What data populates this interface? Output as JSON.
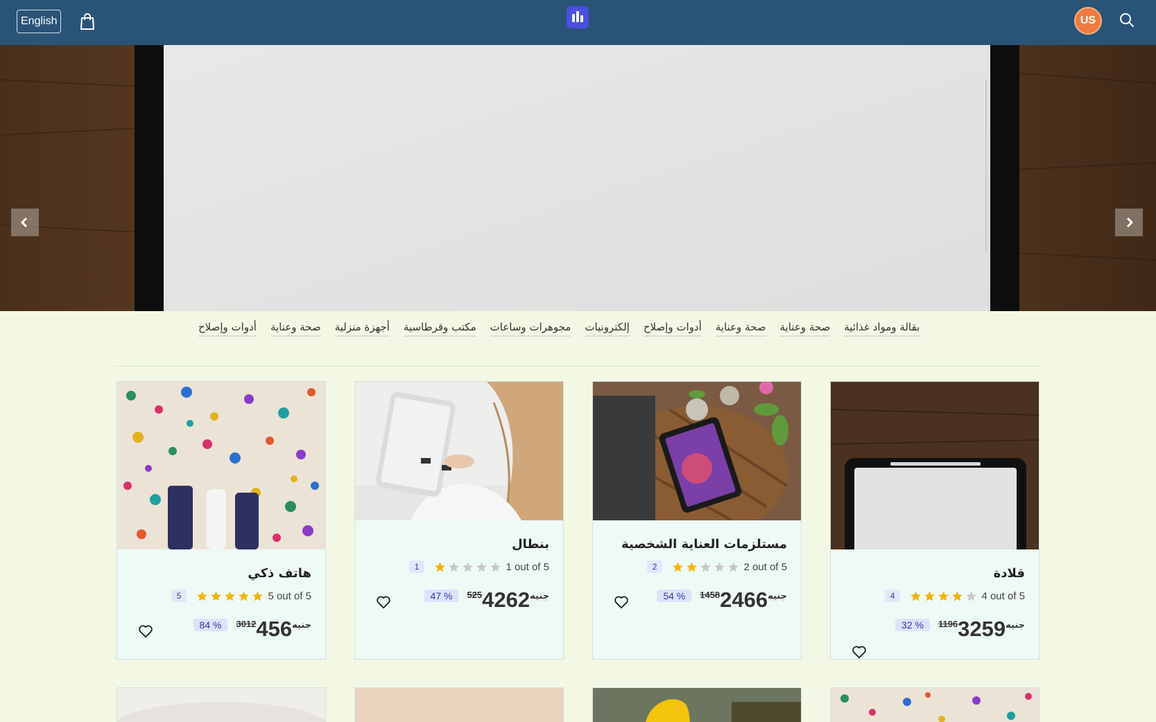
{
  "header": {
    "language_label": "English",
    "avatar_initials": "US"
  },
  "colors": {
    "header_bg": "#295477",
    "page_bg": "#f2f8e3",
    "avatar_bg": "#ef7b43",
    "logo_bg": "#4a4fe0",
    "star_filled": "#f5b301",
    "star_empty": "#c8c8c8"
  },
  "hero": {
    "prev_icon": "chevron-left-icon",
    "next_icon": "chevron-right-icon"
  },
  "categories": [
    "بقالة ومواد غذائية",
    "صحة وعناية",
    "صحة وعناية",
    "أدوات وإصلاح",
    "إلكترونيات",
    "مجوهرات وساعات",
    "مكتب وقرطاسية",
    "أجهزة منزلية",
    "صحة وعناية",
    "أدوات وإصلاح"
  ],
  "products": [
    {
      "title": "قلادة",
      "rating_text": "4 out of 5",
      "rating": 4,
      "rating_badge": "4",
      "currency": "جنيه",
      "price": "3259",
      "old_price": "1196",
      "discount": "32 %"
    },
    {
      "title": "مستلزمات العناية الشخصية",
      "rating_text": "2 out of 5",
      "rating": 2,
      "rating_badge": "2",
      "currency": "جنيه",
      "price": "2466",
      "old_price": "1458",
      "discount": "54 %"
    },
    {
      "title": "بنطال",
      "rating_text": "1 out of 5",
      "rating": 1,
      "rating_badge": "1",
      "currency": "جنيه",
      "price": "4262",
      "old_price": "525",
      "discount": "47 %"
    },
    {
      "title": "هاتف ذكي",
      "rating_text": "5 out of 5",
      "rating": 5,
      "rating_badge": "5",
      "currency": "جنيه",
      "price": "456",
      "old_price": "3012",
      "discount": "84 %"
    }
  ]
}
